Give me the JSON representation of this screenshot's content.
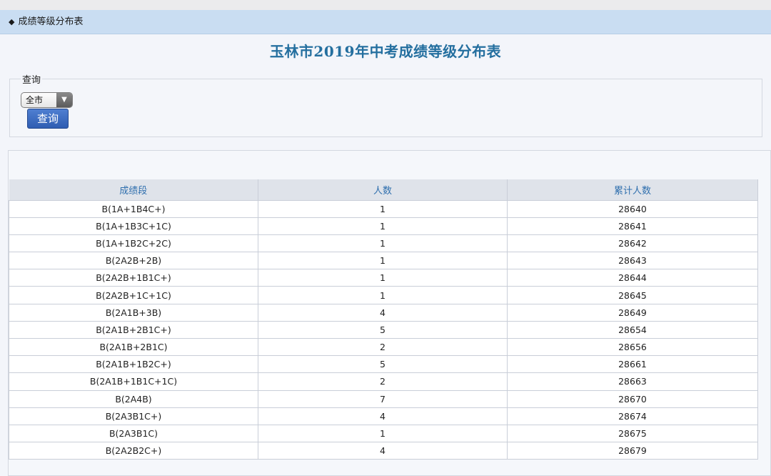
{
  "breadcrumb": "成绩等级分布表",
  "title": "玉林市2019年中考成绩等级分布表",
  "query": {
    "legend": "查询",
    "select_value": "全市",
    "button_label": "查询"
  },
  "table": {
    "headers": [
      "成绩段",
      "人数",
      "累计人数"
    ],
    "rows": [
      [
        "B(1A+1B4C+)",
        "1",
        "28640"
      ],
      [
        "B(1A+1B3C+1C)",
        "1",
        "28641"
      ],
      [
        "B(1A+1B2C+2C)",
        "1",
        "28642"
      ],
      [
        "B(2A2B+2B)",
        "1",
        "28643"
      ],
      [
        "B(2A2B+1B1C+)",
        "1",
        "28644"
      ],
      [
        "B(2A2B+1C+1C)",
        "1",
        "28645"
      ],
      [
        "B(2A1B+3B)",
        "4",
        "28649"
      ],
      [
        "B(2A1B+2B1C+)",
        "5",
        "28654"
      ],
      [
        "B(2A1B+2B1C)",
        "2",
        "28656"
      ],
      [
        "B(2A1B+1B2C+)",
        "5",
        "28661"
      ],
      [
        "B(2A1B+1B1C+1C)",
        "2",
        "28663"
      ],
      [
        "B(2A4B)",
        "7",
        "28670"
      ],
      [
        "B(2A3B1C+)",
        "4",
        "28674"
      ],
      [
        "B(2A3B1C)",
        "1",
        "28675"
      ],
      [
        "B(2A2B2C+)",
        "4",
        "28679"
      ]
    ]
  },
  "colors": {
    "breadcrumb_bg": "#c9ddf2",
    "title": "#246f9f",
    "header_text": "#2f6fae",
    "button_bg": "#3a68bf"
  }
}
